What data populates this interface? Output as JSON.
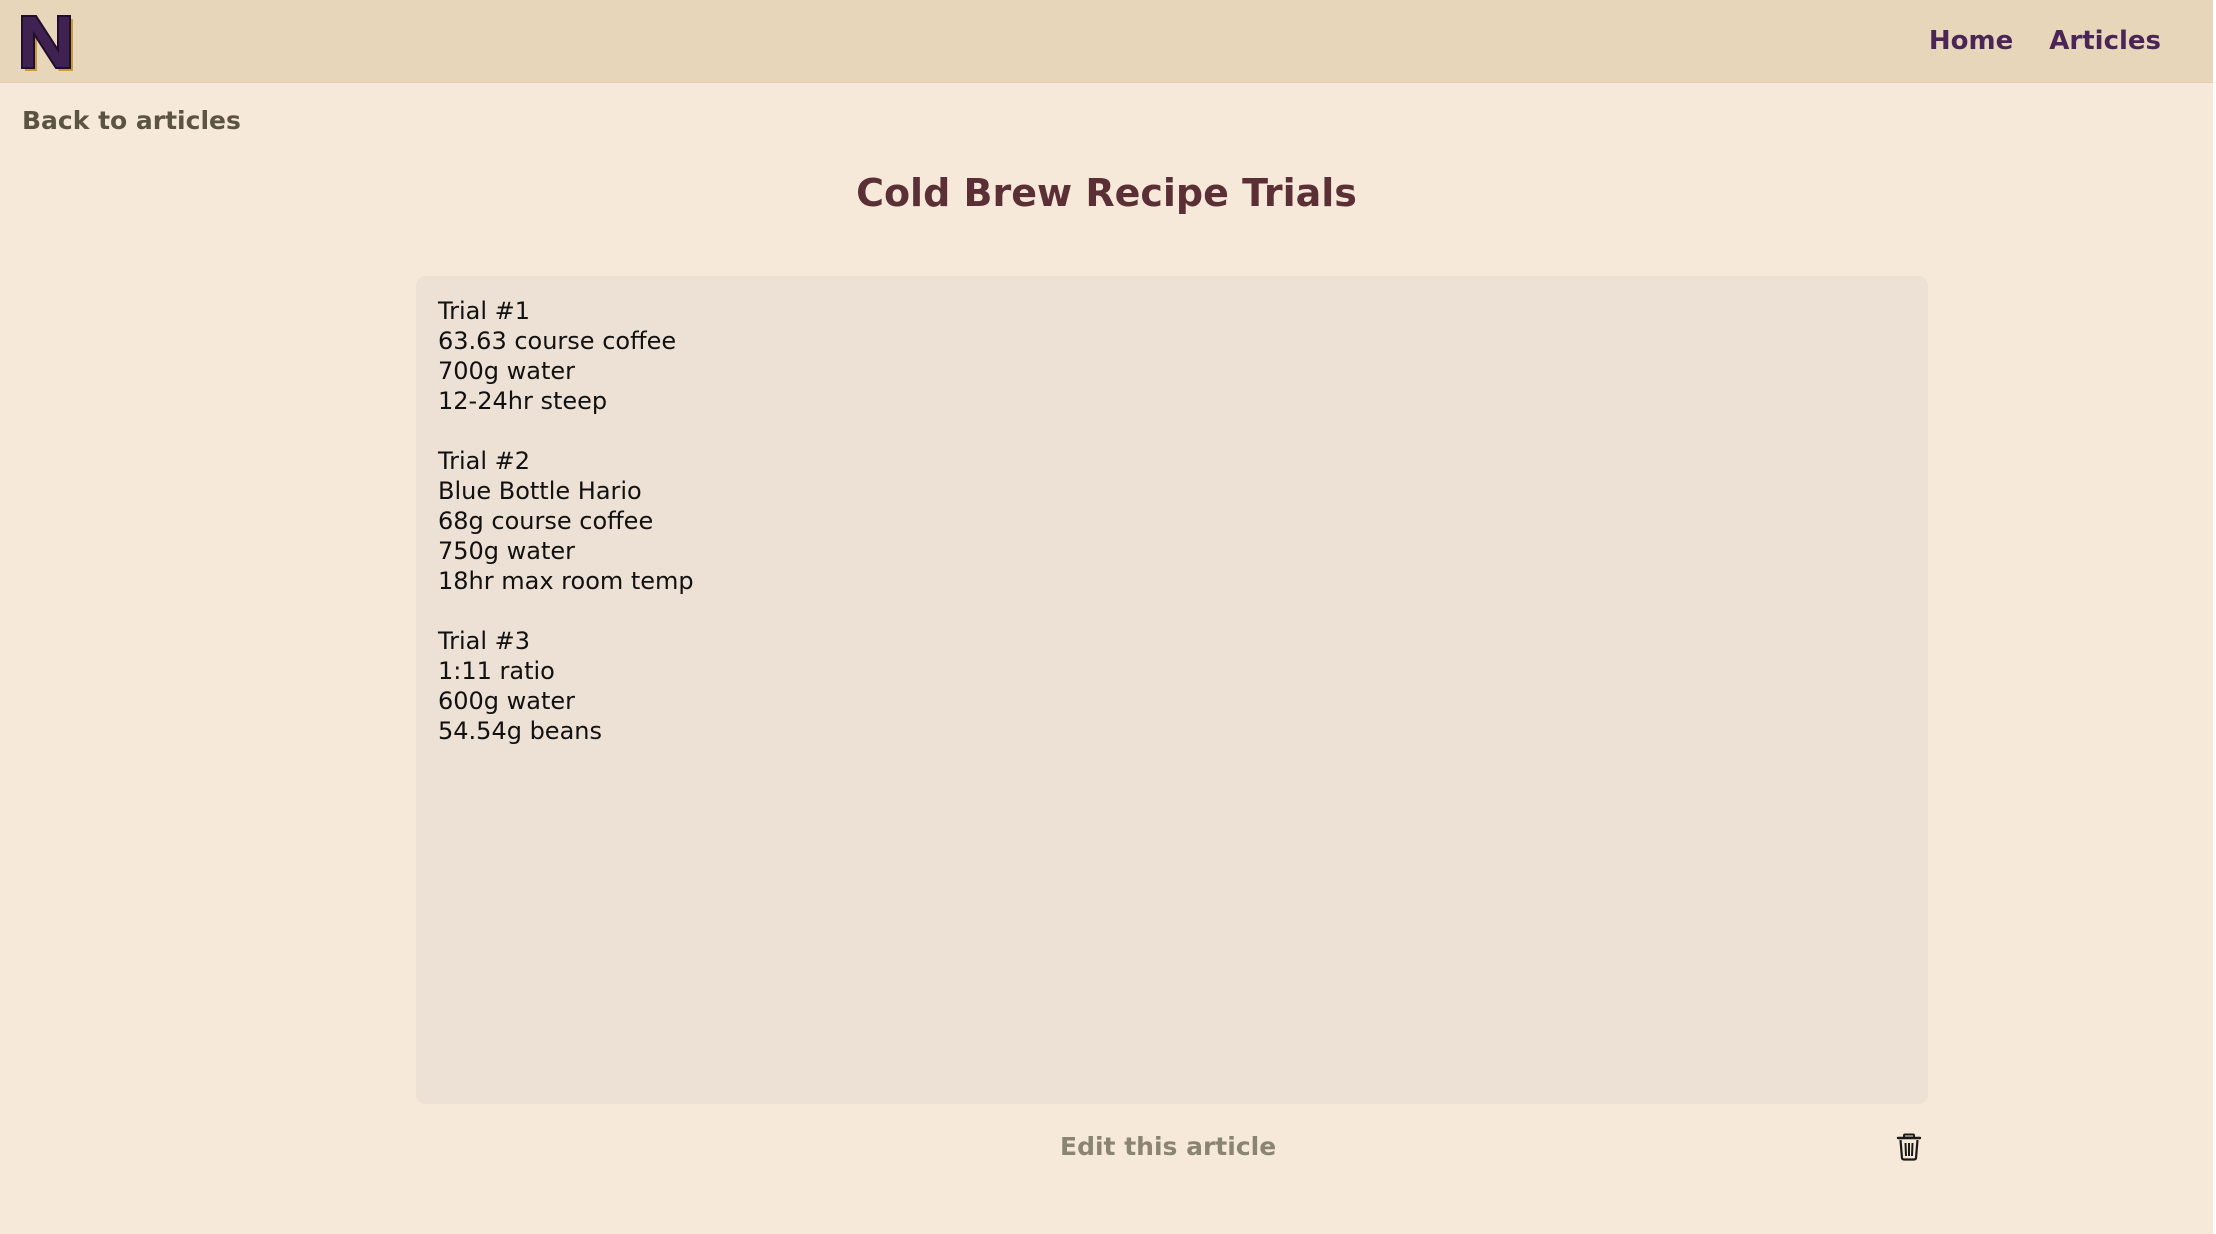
{
  "header": {
    "logo_letter": "N",
    "nav": [
      {
        "label": "Home"
      },
      {
        "label": "Articles"
      }
    ]
  },
  "back_link": "Back to articles",
  "article": {
    "title": "Cold Brew Recipe Trials",
    "body": "Trial #1\n63.63 course coffee\n700g water\n12-24hr steep\n\nTrial #2\nBlue Bottle Hario\n68g course coffee\n750g water\n18hr max room temp\n\nTrial #3\n1:11 ratio\n600g water\n54.54g beans"
  },
  "actions": {
    "edit_label": "Edit this article",
    "delete_icon": "trash-icon"
  },
  "colors": {
    "page_background": "#f7e9d9",
    "header_background": "#e8d6bb",
    "nav_text": "#4a2556",
    "title_text": "#5a2f36",
    "content_background": "#ede0d4"
  }
}
